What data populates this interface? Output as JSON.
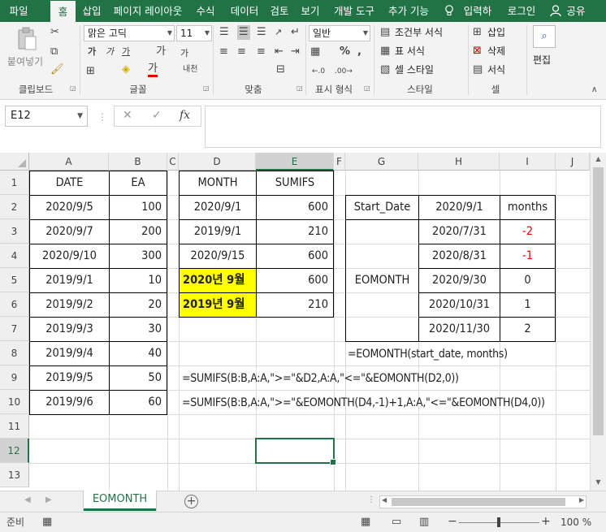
{
  "ribbon_tabs": [
    "파일",
    "홈",
    "삽입",
    "페이지 레이아웃",
    "수식",
    "데이터",
    "검토",
    "보기",
    "개발 도구",
    "추가 기능",
    "입력하세…",
    "로그인",
    "공유"
  ],
  "ribbon": {
    "paste_label": "붙여넣기",
    "font_name": "맑은 고딕",
    "font_size": "11",
    "number_format": "일반",
    "cond_format": "조건부 서식",
    "table_format": "표 서식",
    "cell_style": "셀 스타일",
    "insert": "삽입",
    "delete": "삭제",
    "format": "서식",
    "edit": "편집",
    "group_clipboard": "클립보드",
    "group_font": "글꼴",
    "group_align": "맞춤",
    "group_number": "표시 형식",
    "group_style": "스타일",
    "group_cells": "셀"
  },
  "formula_bar": {
    "name_box": "E12",
    "formula": ""
  },
  "columns": [
    "A",
    "B",
    "C",
    "D",
    "E",
    "F",
    "G",
    "H",
    "I",
    "J"
  ],
  "rows": [
    "1",
    "2",
    "3",
    "4",
    "5",
    "6",
    "7",
    "8",
    "9",
    "10",
    "11",
    "12",
    "13"
  ],
  "sheet": {
    "table1": {
      "headers": [
        "DATE",
        "EA"
      ],
      "rows": [
        [
          "2020/9/5",
          "100"
        ],
        [
          "2020/9/7",
          "200"
        ],
        [
          "2020/9/10",
          "300"
        ],
        [
          "2019/9/1",
          "10"
        ],
        [
          "2019/9/2",
          "20"
        ],
        [
          "2019/9/3",
          "30"
        ],
        [
          "2019/9/4",
          "40"
        ],
        [
          "2019/9/5",
          "50"
        ],
        [
          "2019/9/6",
          "60"
        ]
      ]
    },
    "table2": {
      "headers": [
        "MONTH",
        "SUMIFS"
      ],
      "rows": [
        [
          "2020/9/1",
          "600"
        ],
        [
          "2019/9/1",
          "210"
        ],
        [
          "2020/9/15",
          "600"
        ],
        [
          "2020년 9월",
          "600"
        ],
        [
          "2019년 9월",
          "210"
        ]
      ]
    },
    "table3": {
      "start_label": "Start_Date",
      "start_value": "2020/9/1",
      "months_label": "months",
      "eomonth_label": "EOMONTH",
      "rows": [
        [
          "2020/7/31",
          "-2"
        ],
        [
          "2020/8/31",
          "-1"
        ],
        [
          "2020/9/30",
          "0"
        ],
        [
          "2020/10/31",
          "1"
        ],
        [
          "2020/11/30",
          "2"
        ]
      ]
    },
    "note_eomonth": "=EOMONTH(start_date, months)",
    "note_sumifs_1": "=SUMIFS(B:B,A:A,\">=\"&D2,A:A,\"<=\"&EOMONTH(D2,0))",
    "note_sumifs_2": "=SUMIFS(B:B,A:A,\">=\"&EOMONTH(D4,-1)+1,A:A,\"<=\"&EOMONTH(D4,0))"
  },
  "sheet_tab": "EOMONTH",
  "status": {
    "ready": "준비",
    "zoom": "100 %"
  },
  "colors": {
    "accent": "#217346",
    "highlight": "#ffff00",
    "negative": "#ee0000"
  }
}
